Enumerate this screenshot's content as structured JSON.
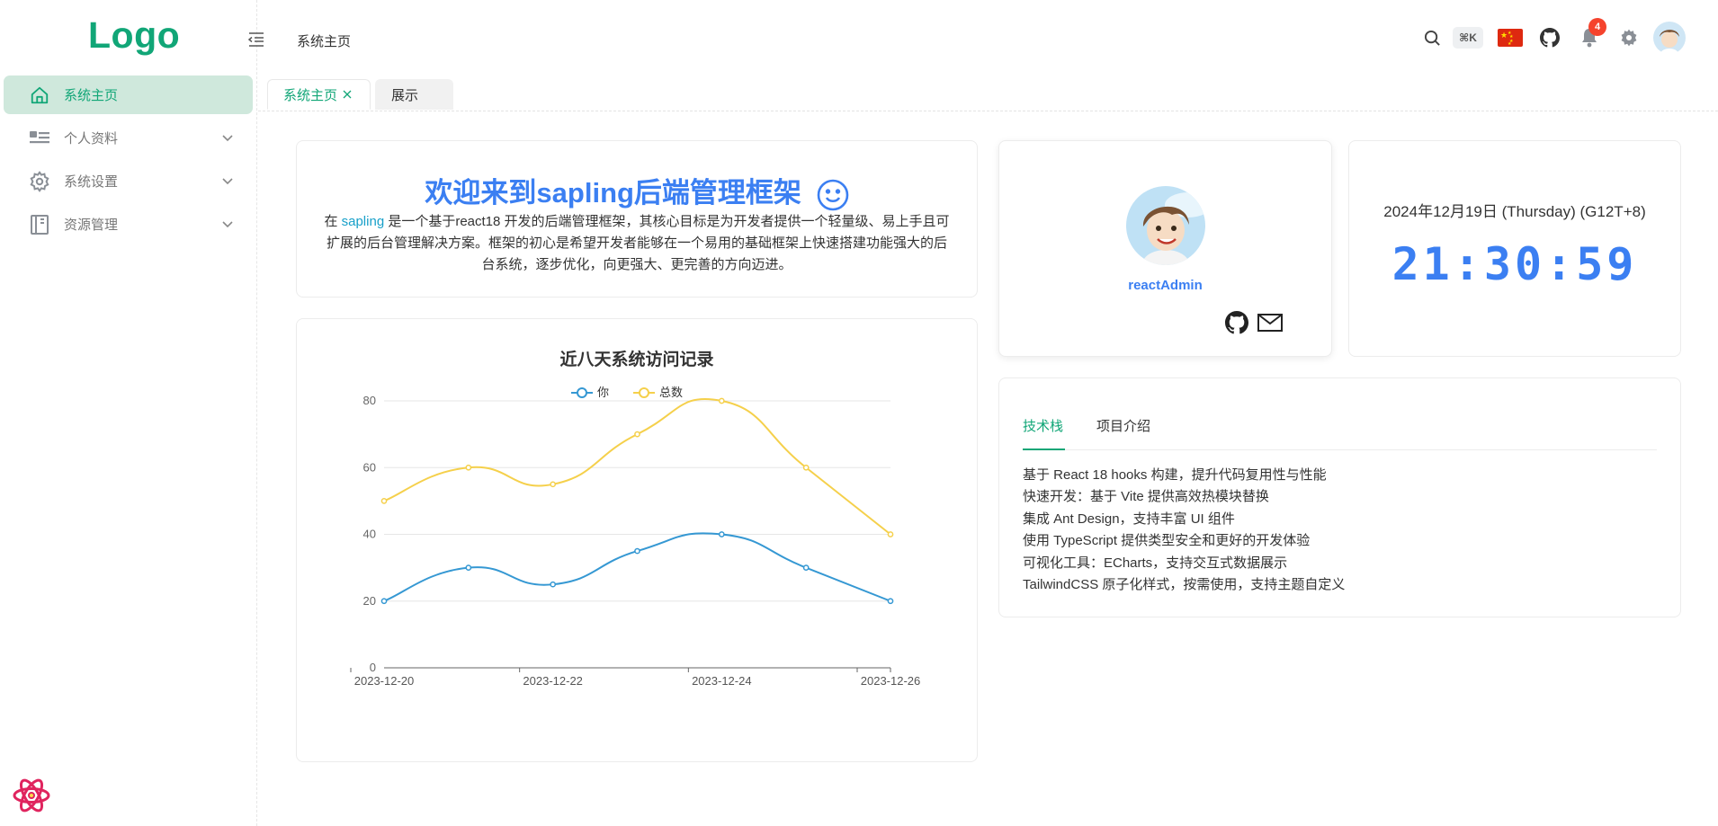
{
  "app": {
    "logo": "Logo"
  },
  "sidebar": {
    "items": [
      {
        "label": "系统主页",
        "icon": "home-icon",
        "active": true
      },
      {
        "label": "个人资料",
        "icon": "profile-icon"
      },
      {
        "label": "系统设置",
        "icon": "gear-icon"
      },
      {
        "label": "资源管理",
        "icon": "book-icon"
      }
    ]
  },
  "header": {
    "breadcrumb": "系统主页",
    "search_shortcut": "⌘K",
    "notification_count": "4",
    "language_flag": "cn-flag-icon"
  },
  "tabs": [
    {
      "label": "系统主页",
      "active": true
    },
    {
      "label": "展示",
      "active": false
    }
  ],
  "welcome": {
    "title": "欢迎来到sapling后端管理框架",
    "desc_prefix": "在 ",
    "desc_link": "sapling",
    "desc_rest": " 是一个基于react18 开发的后端管理框架，其核心目标是为开发者提供一个轻量级、易上手且可扩展的后台管理解决方案。框架的初心是希望开发者能够在一个易用的基础框架上快速搭建功能强大的后台系统，逐步优化，向更强大、更完善的方向迈进。"
  },
  "profile": {
    "name": "reactAdmin"
  },
  "clock": {
    "date": "2024年12月19日 (Thursday) (G12T+8)",
    "time": "21:30:59"
  },
  "stack": {
    "tabs": [
      "技术栈",
      "项目介绍"
    ],
    "items": [
      "基于 React 18 hooks 构建，提升代码复用性与性能",
      "快速开发：基于 Vite 提供高效热模块替换",
      "集成 Ant Design，支持丰富 UI 组件",
      "使用 TypeScript 提供类型安全和更好的开发体验",
      "可视化工具：ECharts，支持交互式数据展示",
      "TailwindCSS 原子化样式，按需使用，支持主题自定义"
    ]
  },
  "colors": {
    "primary": "#11a677",
    "accent": "#3b7ff2",
    "series_you": "#3598d3",
    "series_total": "#f5d04b"
  },
  "chart_data": {
    "type": "line",
    "title": "近八天系统访问记录",
    "x": [
      "2023-12-20",
      "2023-12-21",
      "2023-12-22",
      "2023-12-23",
      "2023-12-24",
      "2023-12-25",
      "2023-12-26"
    ],
    "x_tick_labels": [
      "2023-12-20",
      "2023-12-22",
      "2023-12-24",
      "2023-12-26"
    ],
    "series": [
      {
        "name": "你",
        "values": [
          20,
          30,
          25,
          35,
          40,
          30,
          20
        ]
      },
      {
        "name": "总数",
        "values": [
          50,
          60,
          55,
          70,
          80,
          60,
          40
        ]
      }
    ],
    "ylim": [
      0,
      80
    ],
    "yticks": [
      0,
      20,
      40,
      60,
      80
    ],
    "smooth": true,
    "legend": "top",
    "grid": true
  }
}
